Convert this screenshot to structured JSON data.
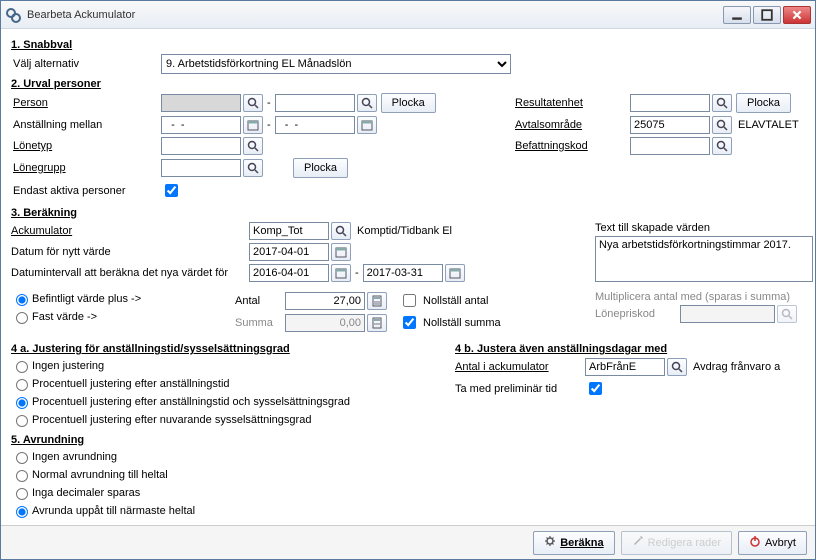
{
  "window": {
    "title": "Bearbeta Ackumulator"
  },
  "s1": {
    "heading": "1. Snabbval",
    "alt_label": "Välj alternativ",
    "alt_selected": "9. Arbetstidsförkortning EL Månadslön"
  },
  "s2": {
    "heading": "2. Urval personer",
    "person_label": "Person",
    "person_from": "",
    "person_to": "",
    "plocka": "Plocka",
    "anst_label": "Anställning mellan",
    "anst_from": "  -  -",
    "anst_to": "  -  -",
    "lonetyp_label": "Lönetyp",
    "lonetyp_value": "",
    "lonegrupp_label": "Lönegrupp",
    "lonegrupp_value": "",
    "endast_label": "Endast aktiva personer",
    "resultat_label": "Resultatenhet",
    "resultat_value": "",
    "avtal_label": "Avtalsområde",
    "avtal_value": "25075",
    "avtal_text": "ELAVTALET",
    "befatt_label": "Befattningskod",
    "befatt_value": ""
  },
  "s3": {
    "heading": "3. Beräkning",
    "ack_label": "Ackumulator",
    "ack_value": "Komp_Tot",
    "ack_desc": "Komptid/Tidbank El",
    "datum_label": "Datum för nytt värde",
    "datum_value": "2017-04-01",
    "interval_label": "Datumintervall att beräkna det nya värdet för",
    "interval_from": "2016-04-01",
    "interval_to": "2017-03-31",
    "opt_befintligt": "Befintligt värde plus ->",
    "opt_fast": "Fast värde ->",
    "antal_label": "Antal",
    "antal_value": "27,00",
    "summa_label": "Summa",
    "summa_value": "0,00",
    "nollstall_antal": "Nollställ antal",
    "nollstall_summa": "Nollställ summa",
    "text_label": "Text till skapade värden",
    "text_value": "Nya arbetstidsförkortningstimmar 2017.",
    "mult_label": "Multiplicera antal med (sparas i summa)",
    "loneprisk_label": "Lönepriskod",
    "loneprisk_value": ""
  },
  "s4a": {
    "heading": "4 a. Justering för anställningstid/sysselsättningsgrad",
    "opt1": "Ingen justering",
    "opt2": "Procentuell justering efter anställningstid",
    "opt3": "Procentuell justering efter anställningstid och sysselsättningsgrad",
    "opt4": "Procentuell justering efter nuvarande sysselsättningsgrad"
  },
  "s4b": {
    "heading": "4 b. Justera även anställningsdagar med",
    "antal_label": "Antal i ackumulator",
    "antal_value": "ArbFrånE",
    "antal_desc": "Avdrag frånvaro a",
    "prelim_label": "Ta med preliminär tid"
  },
  "s5": {
    "heading": "5. Avrundning",
    "opt1": "Ingen avrundning",
    "opt2": "Normal avrundning till heltal",
    "opt3": "Inga decimaler sparas",
    "opt4": "Avrunda uppåt till närmaste heltal"
  },
  "footer": {
    "berakna": "Beräkna",
    "redigera": "Redigera rader",
    "avbryt": "Avbryt"
  }
}
